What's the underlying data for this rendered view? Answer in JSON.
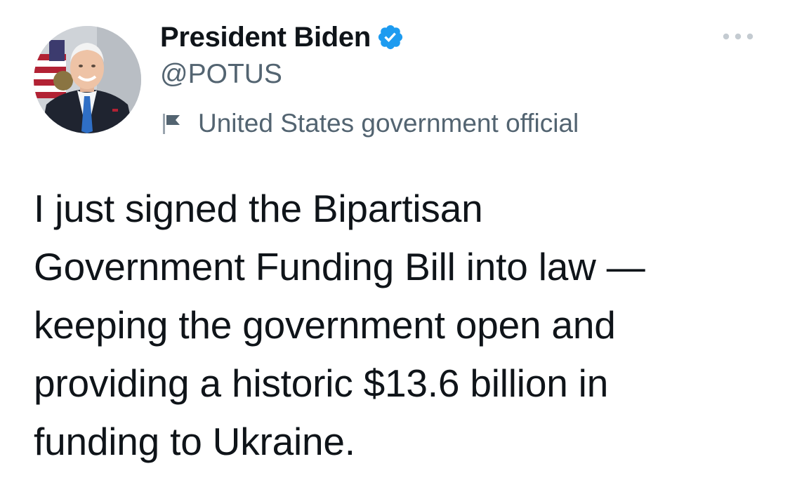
{
  "tweet": {
    "author": {
      "display_name": "President Biden",
      "handle": "@POTUS",
      "verified": true,
      "avatar_icon": "profile-photo",
      "account_label": "United States government official",
      "label_icon": "flag-icon"
    },
    "more_icon": "more-horizontal-icon",
    "text": "I just signed the Bipartisan\nGovernment Funding Bill into law —\nkeeping the government open and\nproviding a historic $13.6 billion in\nfunding to Ukraine."
  },
  "colors": {
    "primary_text": "#0f1419",
    "secondary_text": "#536471",
    "verified_blue": "#1d9bf0",
    "background": "#ffffff"
  }
}
